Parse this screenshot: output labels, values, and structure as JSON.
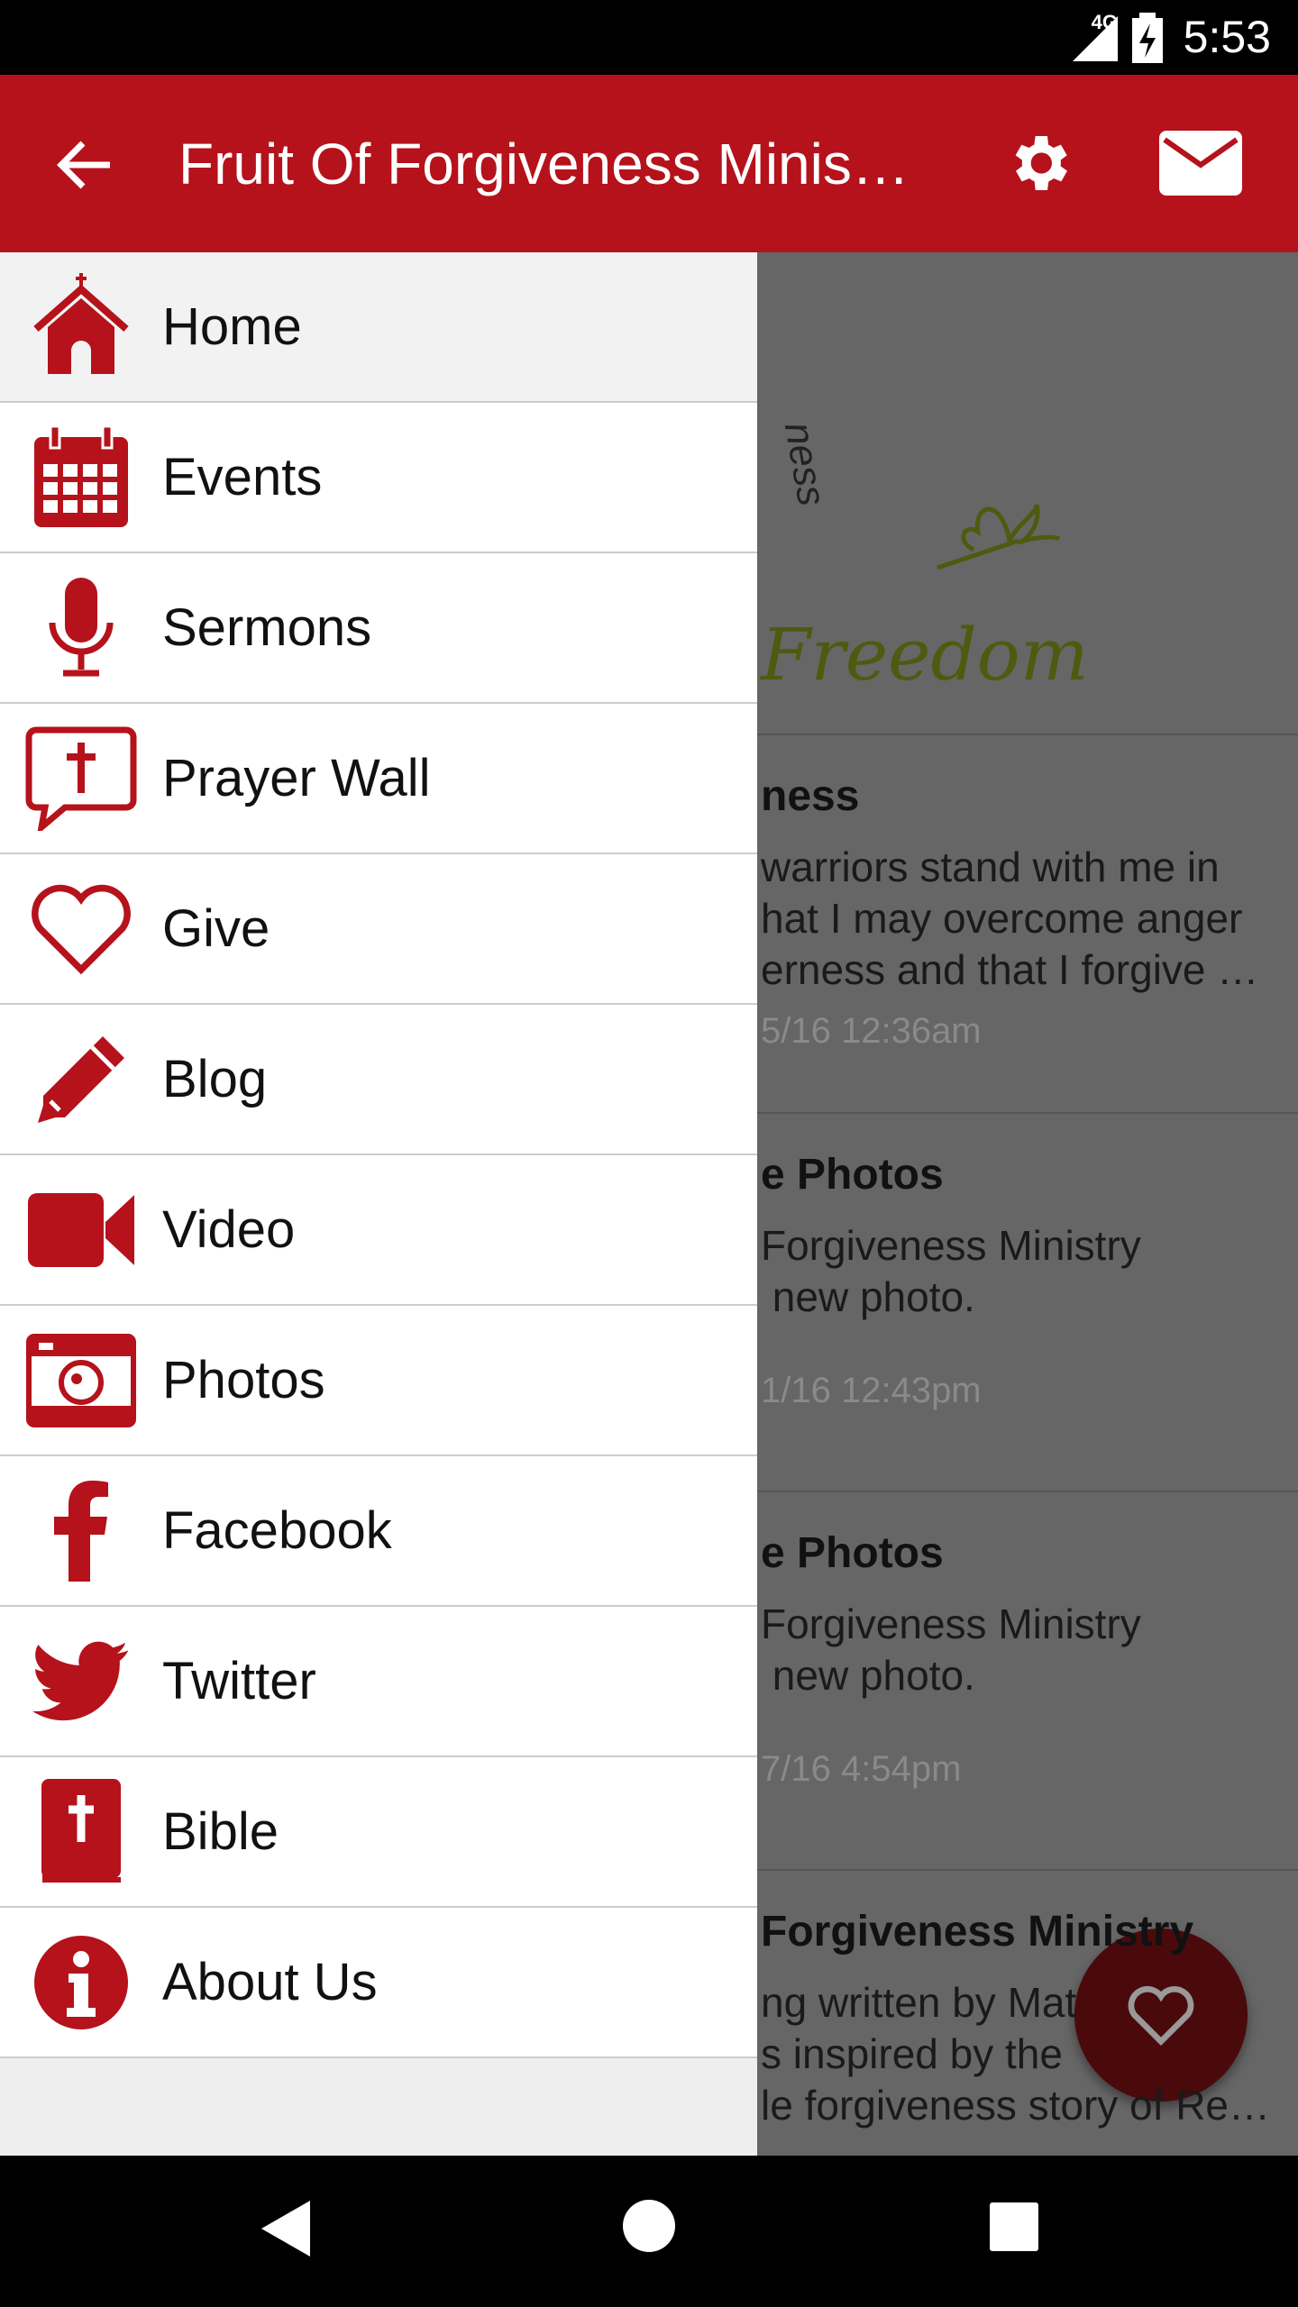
{
  "status_bar": {
    "network": "4G",
    "time": "5:53"
  },
  "app_bar": {
    "title": "Fruit Of Forgiveness Minis…",
    "accent": "#b5121b"
  },
  "drawer": {
    "items": [
      {
        "label": "Home",
        "icon": "church-icon"
      },
      {
        "label": "Events",
        "icon": "calendar-icon"
      },
      {
        "label": "Sermons",
        "icon": "microphone-icon"
      },
      {
        "label": "Prayer Wall",
        "icon": "prayer-bubble-icon"
      },
      {
        "label": "Give",
        "icon": "heart-icon"
      },
      {
        "label": "Blog",
        "icon": "pencil-icon"
      },
      {
        "label": "Video",
        "icon": "video-camera-icon"
      },
      {
        "label": "Photos",
        "icon": "camera-icon"
      },
      {
        "label": "Facebook",
        "icon": "facebook-icon"
      },
      {
        "label": "Twitter",
        "icon": "twitter-icon"
      },
      {
        "label": "Bible",
        "icon": "bible-icon"
      },
      {
        "label": "About Us",
        "icon": "info-icon"
      }
    ]
  },
  "content": {
    "logo_text": "Freedom",
    "logo_curve_text": "ness",
    "posts": [
      {
        "title": "ness",
        "body": "warriors stand with me in\nhat I may overcome anger\nerness and that I forgive …",
        "date": "5/16 12:36am"
      },
      {
        "title": "e Photos",
        "body": "Forgiveness Ministry\n new photo.",
        "date": "1/16 12:43pm"
      },
      {
        "title": "e Photos",
        "body": "Forgiveness Ministry\n new photo.",
        "date": "7/16 4:54pm"
      },
      {
        "title": " Forgiveness Ministry",
        "body": "ng written by Mat\ns inspired by the\nle forgiveness story of Re…",
        "date": ""
      }
    ]
  }
}
